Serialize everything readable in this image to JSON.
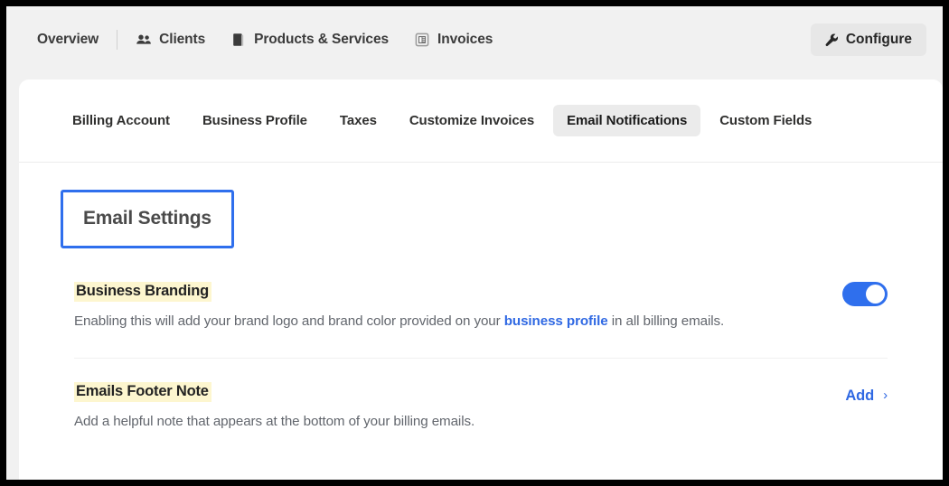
{
  "topnav": {
    "items": [
      {
        "label": "Overview",
        "icon": ""
      },
      {
        "label": "Clients",
        "icon": "people-icon"
      },
      {
        "label": "Products & Services",
        "icon": "box-icon"
      },
      {
        "label": "Invoices",
        "icon": "invoice-icon"
      }
    ],
    "configure_label": "Configure",
    "configure_icon": "wrench-icon"
  },
  "tabs": [
    {
      "label": "Billing Account",
      "active": false
    },
    {
      "label": "Business Profile",
      "active": false
    },
    {
      "label": "Taxes",
      "active": false
    },
    {
      "label": "Customize Invoices",
      "active": false
    },
    {
      "label": "Email Notifications",
      "active": true
    },
    {
      "label": "Custom Fields",
      "active": false
    }
  ],
  "page": {
    "heading": "Email Settings"
  },
  "settings": {
    "business_branding": {
      "label": "Business Branding",
      "desc_before": "Enabling this will add your brand logo and brand color provided on your ",
      "desc_link": "business profile",
      "desc_after": " in all billing emails.",
      "toggle_on": true
    },
    "emails_footer_note": {
      "label": "Emails Footer Note",
      "desc": "Add a helpful note that appears at the bottom of your billing emails.",
      "action_label": "Add",
      "action_chevron": "›"
    }
  },
  "colors": {
    "accent_blue": "#2f6fed",
    "link_blue": "#3069e3",
    "highlight_yellow": "#fdf6cf",
    "active_tab_gray": "#ebebeb",
    "page_gray": "#f1f1f1"
  }
}
